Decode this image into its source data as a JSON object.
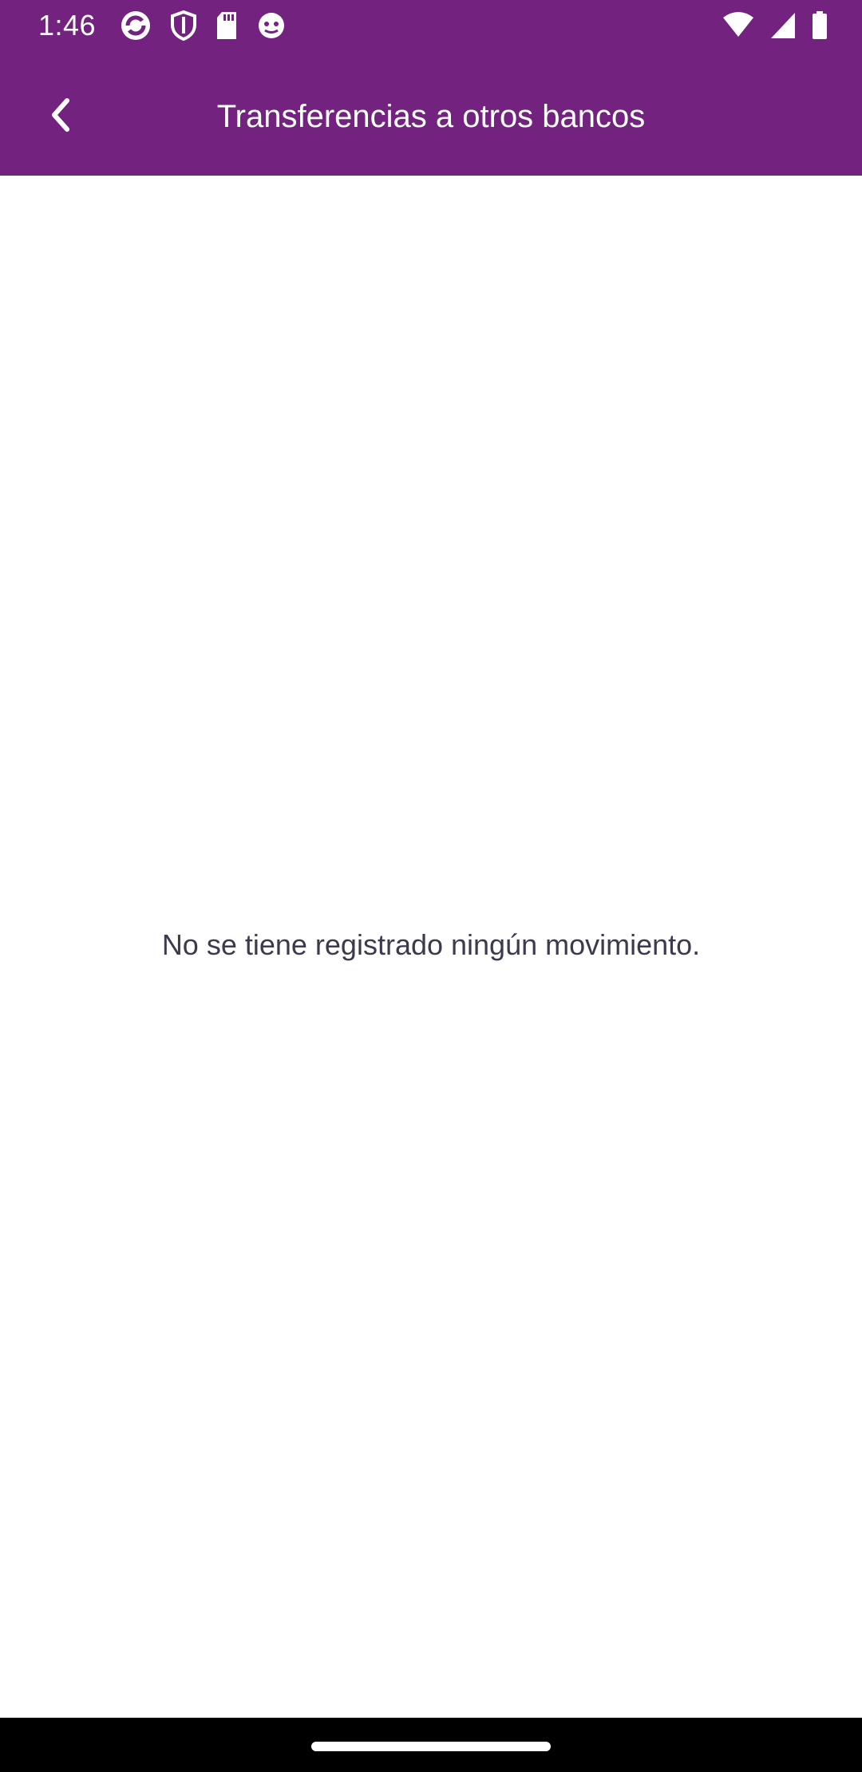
{
  "status_bar": {
    "time": "1:46",
    "left_icons": [
      "sync-app-icon",
      "shield-icon",
      "sd-card-icon",
      "face-app-icon"
    ],
    "right_icons": [
      "wifi-icon",
      "cellular-signal-icon",
      "battery-icon"
    ]
  },
  "app_bar": {
    "title": "Transferencias a otros bancos",
    "back_icon": "chevron-left-icon",
    "background_color": "#73237f"
  },
  "content": {
    "empty_message": "No se tiene registrado ningún movimiento."
  },
  "colors": {
    "primary": "#73237f",
    "text_on_primary": "#ffffff",
    "body_text": "#3c3a4d",
    "background": "#ffffff"
  }
}
